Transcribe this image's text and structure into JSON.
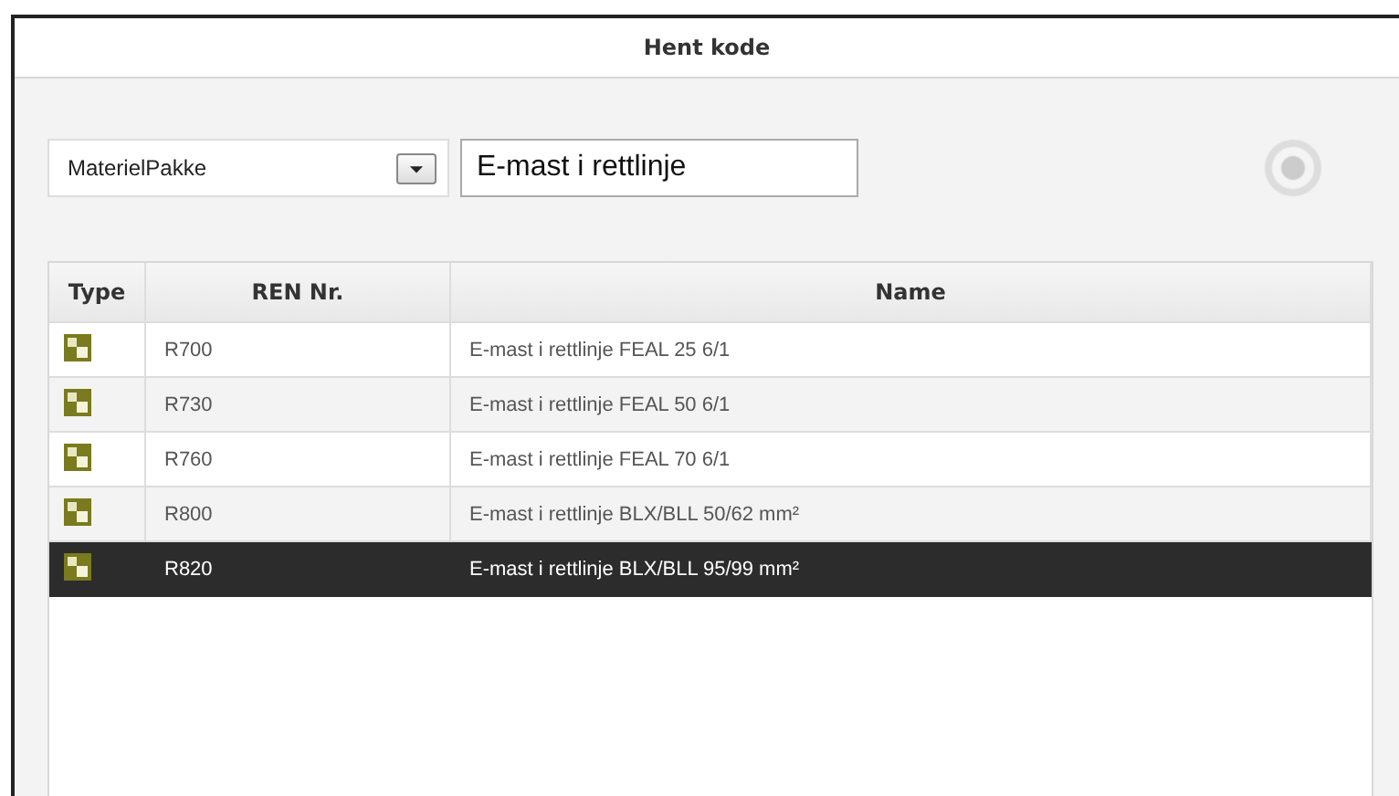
{
  "window": {
    "title": "Hent kode"
  },
  "filter": {
    "type_value": "MaterielPakke",
    "search_value": "E-mast i rettlinje"
  },
  "table": {
    "columns": [
      "Type",
      "REN Nr.",
      "Name"
    ],
    "rows": [
      {
        "ren": "R700",
        "name": "E-mast i rettlinje FEAL 25 6/1",
        "selected": false
      },
      {
        "ren": "R730",
        "name": "E-mast i rettlinje FEAL 50 6/1",
        "selected": false
      },
      {
        "ren": "R760",
        "name": "E-mast i rettlinje FEAL 70 6/1",
        "selected": false
      },
      {
        "ren": "R800",
        "name": "E-mast i rettlinje BLX/BLL 50/62 mm²",
        "selected": false
      },
      {
        "ren": "R820",
        "name": "E-mast i rettlinje BLX/BLL 95/99 mm²",
        "selected": true
      }
    ]
  }
}
